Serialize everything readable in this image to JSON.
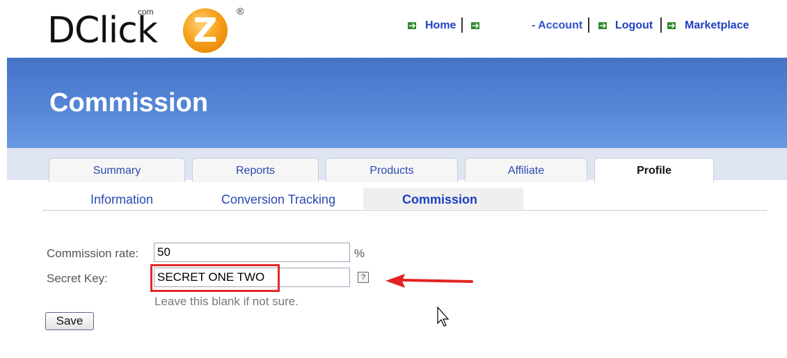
{
  "brand": {
    "logo_text": "DClick",
    "logo_com": "com",
    "logo_z": "Z",
    "logo_reg": "®"
  },
  "topnav": {
    "home": "Home",
    "account": "- Account",
    "logout": "Logout",
    "marketplace": "Marketplace"
  },
  "header": {
    "title": "Commission"
  },
  "tabs": [
    {
      "label": "Summary"
    },
    {
      "label": "Reports"
    },
    {
      "label": "Products"
    },
    {
      "label": "Affiliate"
    },
    {
      "label": "Profile"
    }
  ],
  "subnav": {
    "information": "Information",
    "conversion": "Conversion Tracking",
    "commission": "Commission"
  },
  "form": {
    "rate_label": "Commission rate:",
    "rate_value": "50",
    "rate_unit": "%",
    "key_label": "Secret Key:",
    "key_value": "SECRET ONE TWO",
    "help": "?",
    "key_hint": "Leave this blank if not sure.",
    "save_label": "Save"
  },
  "colors": {
    "header_blue": "#4f80d0",
    "link_blue": "#1f3fbf",
    "highlight_red": "#e02a2a"
  }
}
